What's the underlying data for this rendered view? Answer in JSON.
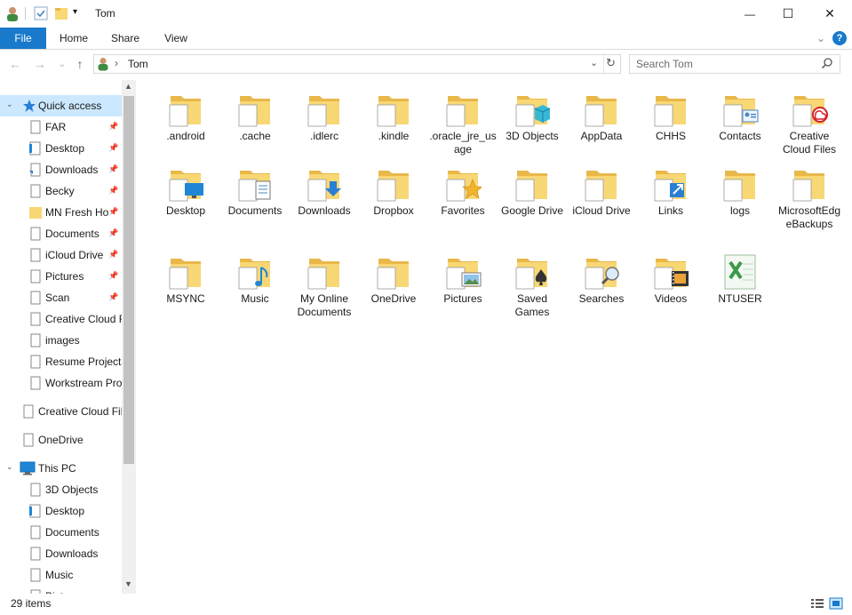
{
  "window": {
    "title": "Tom",
    "minimize_glyph": "—",
    "maximize_glyph": "☐",
    "close_glyph": "✕"
  },
  "ribbon": {
    "tabs": [
      "File",
      "Home",
      "Share",
      "View"
    ],
    "help_glyph": "?"
  },
  "address": {
    "path_separator": "›",
    "location": "Tom",
    "search_placeholder": "Search Tom"
  },
  "nav": {
    "items": [
      {
        "label": "Quick access",
        "icon": "star-icon",
        "pinned": false
      },
      {
        "label": "FAR",
        "icon": "document-icon",
        "pinned": true
      },
      {
        "label": "Desktop",
        "icon": "desktop-icon",
        "pinned": true
      },
      {
        "label": "Downloads",
        "icon": "download-icon",
        "pinned": true
      },
      {
        "label": "Becky",
        "icon": "document-icon",
        "pinned": true
      },
      {
        "label": "MN Fresh Ho",
        "icon": "folder-icon",
        "pinned": true
      },
      {
        "label": "Documents",
        "icon": "document-icon",
        "pinned": true
      },
      {
        "label": "iCloud Drive",
        "icon": "document-icon",
        "pinned": true
      },
      {
        "label": "Pictures",
        "icon": "document-icon",
        "pinned": true
      },
      {
        "label": "Scan",
        "icon": "document-icon",
        "pinned": true
      },
      {
        "label": "Creative Cloud F",
        "icon": "document-icon",
        "pinned": false
      },
      {
        "label": "images",
        "icon": "document-icon",
        "pinned": false
      },
      {
        "label": "Resume Projects",
        "icon": "document-icon",
        "pinned": false
      },
      {
        "label": "Workstream Pro",
        "icon": "document-icon",
        "pinned": false
      },
      {
        "label": "Creative Cloud Fil",
        "icon": "document-icon",
        "pinned": false
      },
      {
        "label": "OneDrive",
        "icon": "document-icon",
        "pinned": false
      },
      {
        "label": "This PC",
        "icon": "computer-icon",
        "pinned": false
      },
      {
        "label": "3D Objects",
        "icon": "document-icon",
        "pinned": false
      },
      {
        "label": "Desktop",
        "icon": "desktop-icon",
        "pinned": false
      },
      {
        "label": "Documents",
        "icon": "document-icon",
        "pinned": false
      },
      {
        "label": "Downloads",
        "icon": "document-icon",
        "pinned": false
      },
      {
        "label": "Music",
        "icon": "document-icon",
        "pinned": false
      },
      {
        "label": "Pictures",
        "icon": "document-icon",
        "pinned": false
      }
    ]
  },
  "files": [
    {
      "name": ".android",
      "icon": "folder-icon"
    },
    {
      "name": ".cache",
      "icon": "folder-icon"
    },
    {
      "name": ".idlerc",
      "icon": "folder-icon"
    },
    {
      "name": ".kindle",
      "icon": "folder-icon"
    },
    {
      "name": ".oracle_jre_usage",
      "icon": "folder-icon"
    },
    {
      "name": "3D Objects",
      "icon": "3d-objects-folder-icon"
    },
    {
      "name": "AppData",
      "icon": "folder-icon"
    },
    {
      "name": "CHHS",
      "icon": "folder-icon"
    },
    {
      "name": "Contacts",
      "icon": "contacts-folder-icon"
    },
    {
      "name": "Creative Cloud Files",
      "icon": "creative-cloud-folder-icon"
    },
    {
      "name": "Desktop",
      "icon": "desktop-folder-icon"
    },
    {
      "name": "Documents",
      "icon": "documents-folder-icon"
    },
    {
      "name": "Downloads",
      "icon": "downloads-folder-icon"
    },
    {
      "name": "Dropbox",
      "icon": "folder-icon"
    },
    {
      "name": "Favorites",
      "icon": "favorites-folder-icon"
    },
    {
      "name": "Google Drive",
      "icon": "folder-icon"
    },
    {
      "name": "iCloud Drive",
      "icon": "folder-icon"
    },
    {
      "name": "Links",
      "icon": "links-folder-icon"
    },
    {
      "name": "logs",
      "icon": "folder-icon"
    },
    {
      "name": "MicrosoftEdgeBackups",
      "icon": "folder-icon"
    },
    {
      "name": "MSYNC",
      "icon": "folder-icon"
    },
    {
      "name": "Music",
      "icon": "music-folder-icon"
    },
    {
      "name": "My Online Documents",
      "icon": "folder-icon"
    },
    {
      "name": "OneDrive",
      "icon": "folder-icon"
    },
    {
      "name": "Pictures",
      "icon": "pictures-folder-icon"
    },
    {
      "name": "Saved Games",
      "icon": "saved-games-folder-icon"
    },
    {
      "name": "Searches",
      "icon": "searches-folder-icon"
    },
    {
      "name": "Videos",
      "icon": "videos-folder-icon"
    },
    {
      "name": "NTUSER",
      "icon": "excel-file-icon"
    }
  ],
  "status": {
    "item_count": "29 items"
  },
  "colors": {
    "accent": "#1979ca",
    "folder": "#f8d775",
    "folder_dark": "#e8b84a",
    "selected": "#cce8ff"
  }
}
